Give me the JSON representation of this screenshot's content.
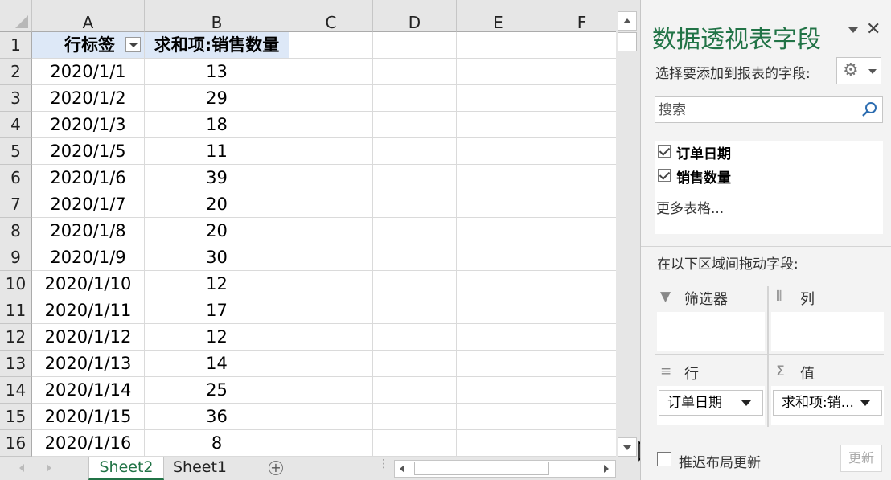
{
  "columns": [
    "A",
    "B",
    "C",
    "D",
    "E",
    "F"
  ],
  "rows": [
    "1",
    "2",
    "3",
    "4",
    "5",
    "6",
    "7",
    "8",
    "9",
    "10",
    "11",
    "12",
    "13",
    "14",
    "15",
    "16"
  ],
  "pivot": {
    "header_label": "行标签",
    "header_value": "求和项:销售数量",
    "data": [
      {
        "date": "2020/1/1",
        "qty": "13"
      },
      {
        "date": "2020/1/2",
        "qty": "29"
      },
      {
        "date": "2020/1/3",
        "qty": "18"
      },
      {
        "date": "2020/1/5",
        "qty": "11"
      },
      {
        "date": "2020/1/6",
        "qty": "39"
      },
      {
        "date": "2020/1/7",
        "qty": "20"
      },
      {
        "date": "2020/1/8",
        "qty": "20"
      },
      {
        "date": "2020/1/9",
        "qty": "30"
      },
      {
        "date": "2020/1/10",
        "qty": "12"
      },
      {
        "date": "2020/1/11",
        "qty": "17"
      },
      {
        "date": "2020/1/12",
        "qty": "12"
      },
      {
        "date": "2020/1/13",
        "qty": "14"
      },
      {
        "date": "2020/1/14",
        "qty": "25"
      },
      {
        "date": "2020/1/15",
        "qty": "36"
      },
      {
        "date": "2020/1/16",
        "qty": "8"
      }
    ]
  },
  "sheets": {
    "active": "Sheet2",
    "other": "Sheet1"
  },
  "pane": {
    "title": "数据透视表字段",
    "close_glyph": "✕",
    "subtitle": "选择要添加到报表的字段:",
    "search_placeholder": "搜索",
    "fields": [
      {
        "label": "订单日期",
        "checked": true
      },
      {
        "label": "销售数量",
        "checked": true
      }
    ],
    "more_tables": "更多表格...",
    "areas_label": "在以下区域间拖动字段:",
    "areas": {
      "filters": "筛选器",
      "columns": "列",
      "rows": "行",
      "values": "值"
    },
    "rows_field": "订单日期",
    "values_field": "求和项:销...",
    "defer_label": "推迟布局更新",
    "update_label": "更新"
  },
  "colors": {
    "accent": "#217346",
    "pivot_header_bg": "#dde8f7"
  }
}
